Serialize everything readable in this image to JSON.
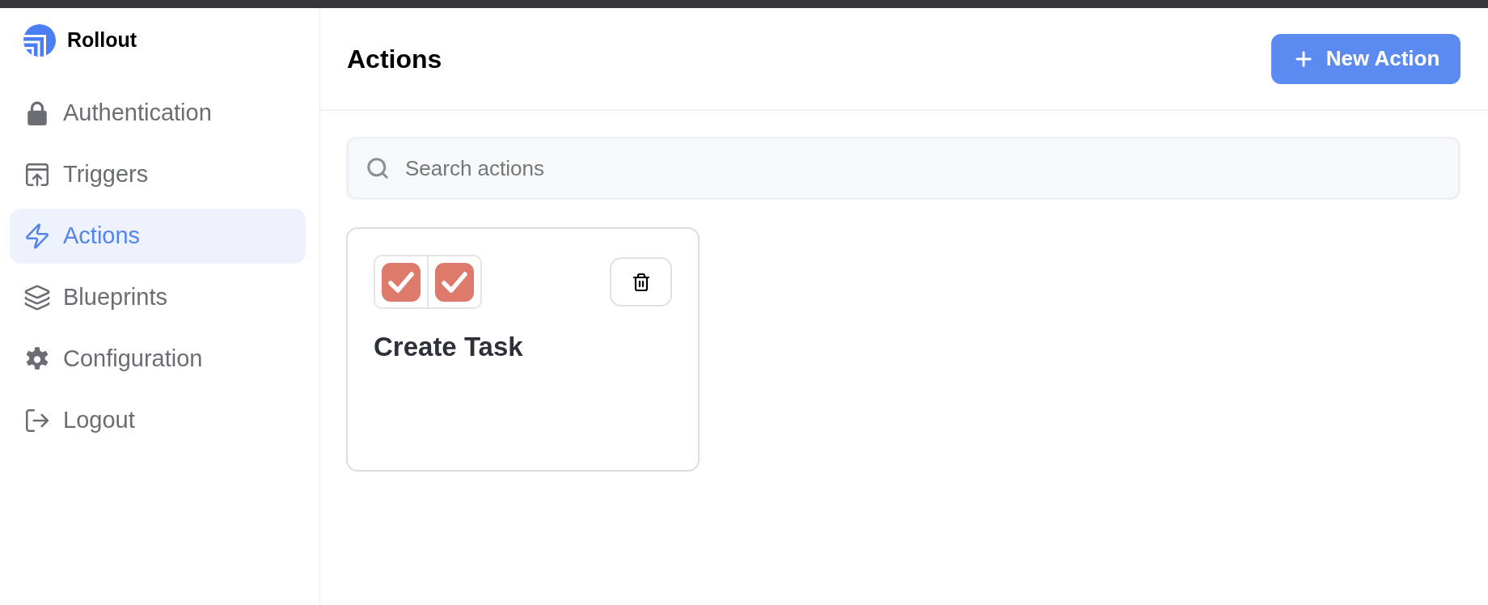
{
  "brand": {
    "name": "Rollout"
  },
  "sidebar": {
    "items": [
      {
        "label": "Authentication",
        "selected": false
      },
      {
        "label": "Triggers",
        "selected": false
      },
      {
        "label": "Actions",
        "selected": true
      },
      {
        "label": "Blueprints",
        "selected": false
      },
      {
        "label": "Configuration",
        "selected": false
      },
      {
        "label": "Logout",
        "selected": false
      }
    ]
  },
  "header": {
    "title": "Actions",
    "new_button": {
      "label": "New Action"
    }
  },
  "search": {
    "placeholder": "Search actions"
  },
  "cards": [
    {
      "title": "Create Task"
    }
  ]
}
